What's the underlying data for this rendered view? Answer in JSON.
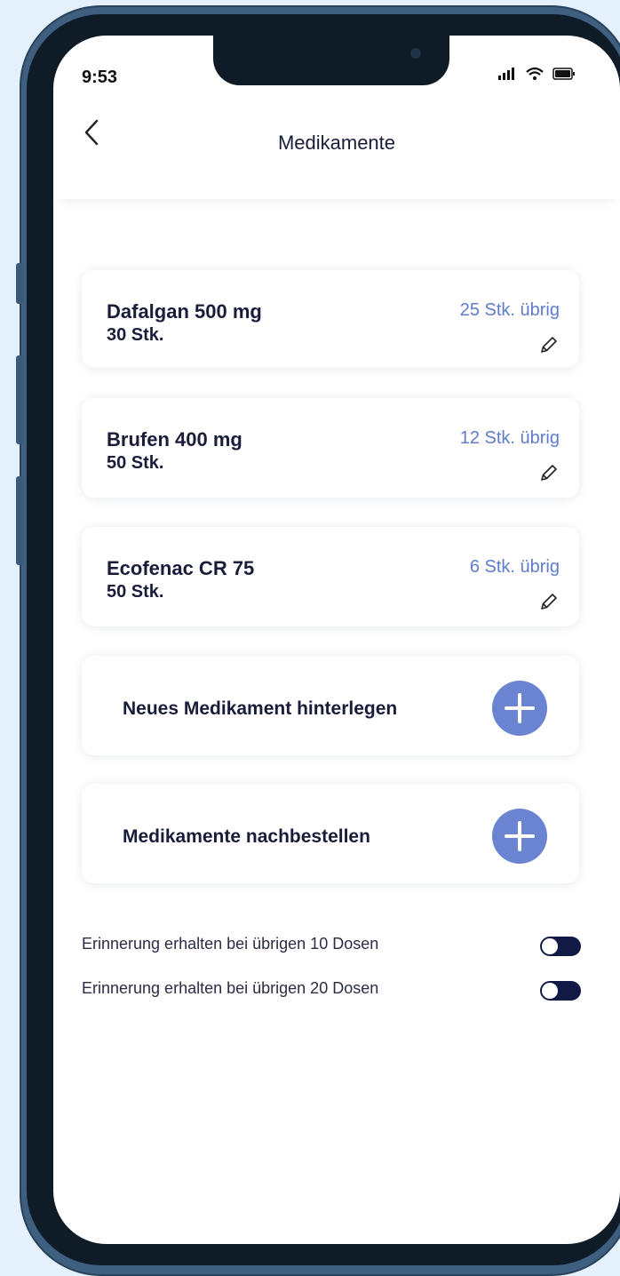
{
  "status_bar": {
    "time": "9:53",
    "icons": [
      "signal-icon",
      "wifi-icon",
      "battery-icon"
    ]
  },
  "header": {
    "back_icon": "chevron-left-icon",
    "title": "Medikamente"
  },
  "medications": [
    {
      "name": "Dafalgan 500 mg",
      "quantity": "30 Stk.",
      "remaining": "25 Stk. übrig",
      "edit_icon": "pencil-icon"
    },
    {
      "name": "Brufen 400 mg",
      "quantity": "50 Stk.",
      "remaining": "12 Stk. übrig",
      "edit_icon": "pencil-icon"
    },
    {
      "name": "Ecofenac CR 75",
      "quantity": "50 Stk.",
      "remaining": "6 Stk. übrig",
      "edit_icon": "pencil-icon"
    }
  ],
  "actions": [
    {
      "label": "Neues Medikament hinterlegen",
      "icon": "plus-circle-icon"
    },
    {
      "label": "Medikamente nachbestellen",
      "icon": "plus-circle-icon"
    }
  ],
  "reminders": [
    {
      "label": "Erinnerung erhalten bei übrigen 10 Dosen",
      "enabled": true
    },
    {
      "label": "Erinnerung erhalten bei übrigen 20 Dosen",
      "enabled": true
    }
  ],
  "colors": {
    "accent": "#6a84d2",
    "remaining_text": "#5e7ccd",
    "dark_text": "#1a1d3a",
    "toggle": "#111a44",
    "frame": "#3e5f7f"
  }
}
